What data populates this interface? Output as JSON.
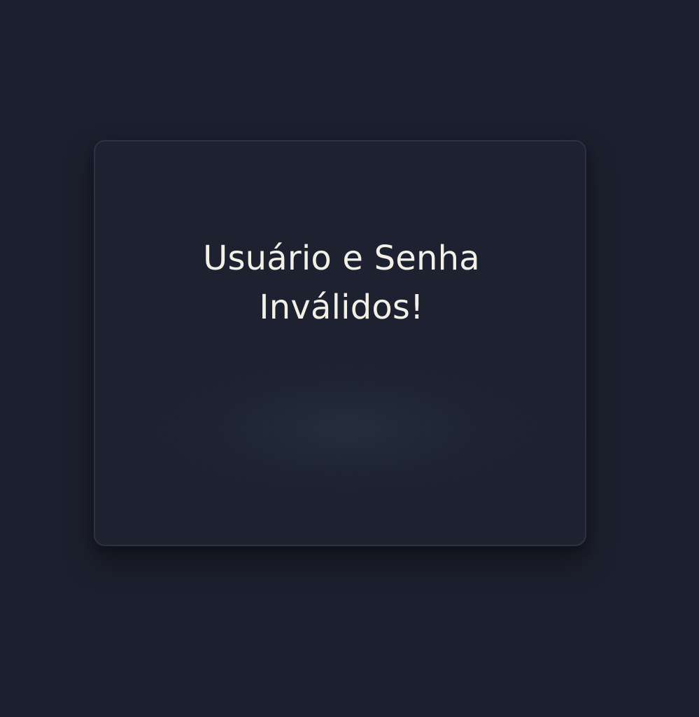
{
  "dialog": {
    "message": "Usuário e Senha Inválidos!"
  },
  "colors": {
    "background": "#1c1f2d",
    "card_background": "#1d2130",
    "card_border": "#2c3148",
    "text": "#f3f0e8"
  }
}
